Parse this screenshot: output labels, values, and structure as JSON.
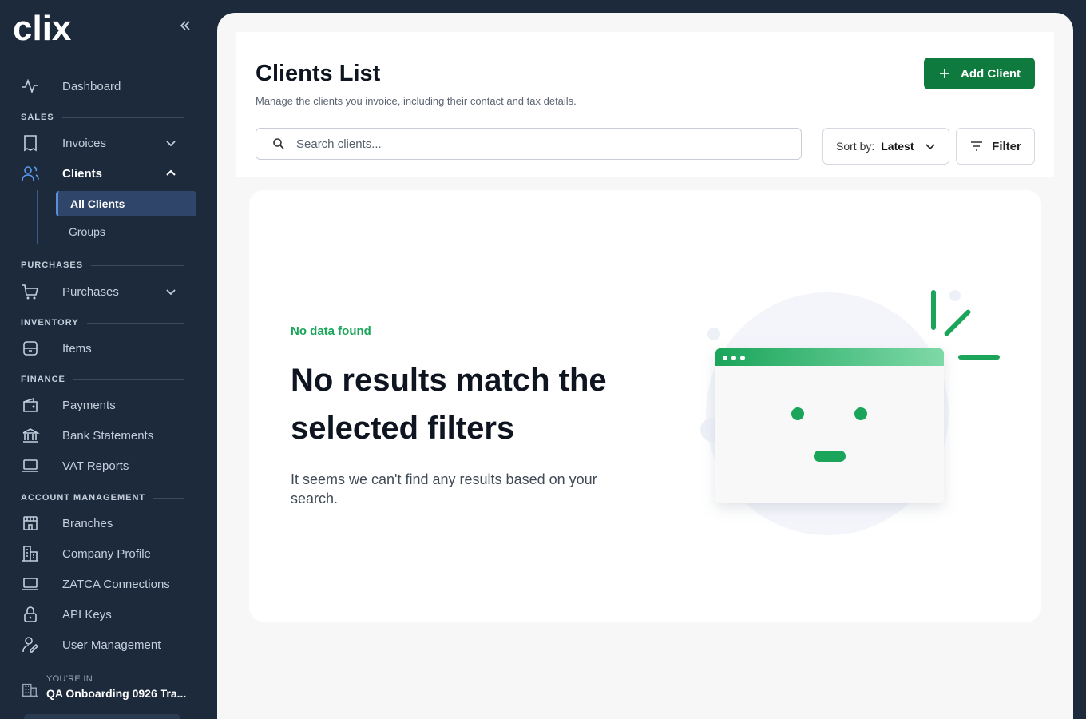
{
  "brand": {
    "logo_text": "clix"
  },
  "sidebar": {
    "dashboard": "Dashboard",
    "sections": {
      "sales": "SALES",
      "purchases": "PURCHASES",
      "inventory": "INVENTORY",
      "finance": "FINANCE",
      "account_management": "ACCOUNT MANAGEMENT"
    },
    "items": {
      "invoices": "Invoices",
      "clients": "Clients",
      "all_clients": "All Clients",
      "groups": "Groups",
      "purchases": "Purchases",
      "items": "Items",
      "payments": "Payments",
      "bank_statements": "Bank Statements",
      "vat_reports": "VAT Reports",
      "branches": "Branches",
      "company_profile": "Company Profile",
      "zatca_connections": "ZATCA Connections",
      "api_keys": "API Keys",
      "user_management": "User Management"
    },
    "org": {
      "caption": "YOU'RE IN",
      "name": "QA Onboarding 0926 Tra..."
    }
  },
  "header": {
    "title": "Clients List",
    "subtitle": "Manage the clients you invoice, including their contact and tax details.",
    "add_button": "Add Client",
    "search_placeholder": "Search clients...",
    "sort_label": "Sort by:",
    "sort_value": "Latest",
    "filter_button": "Filter"
  },
  "empty_state": {
    "tag": "No data found",
    "heading": "No results match the selected filters",
    "description": "It seems we can't find any results based on your search."
  },
  "colors": {
    "sidebar_bg": "#1d2a3b",
    "primary_green": "#0f7a3d",
    "accent_green": "#1aa55a",
    "active_nav_bg": "#2f4569"
  }
}
